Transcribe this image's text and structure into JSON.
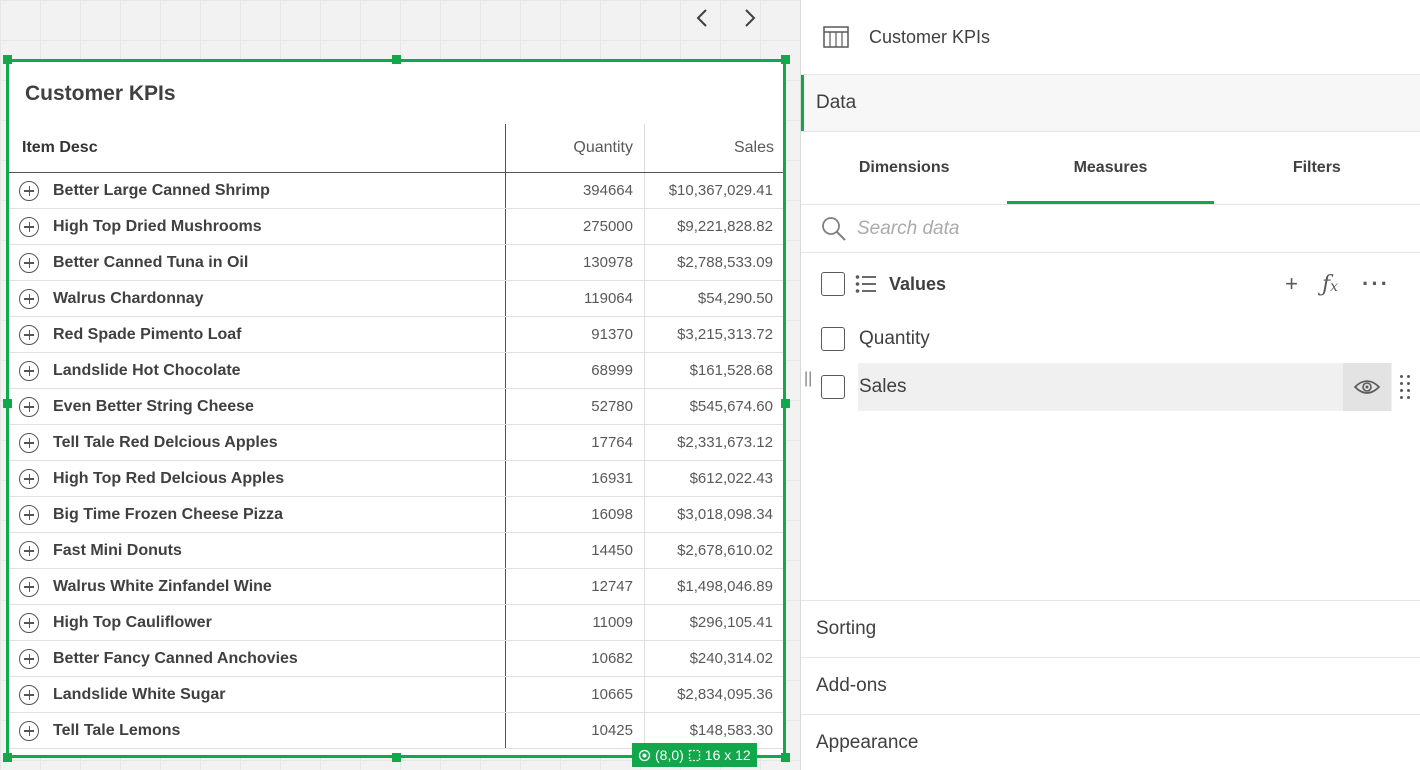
{
  "canvas": {
    "object_title": "Customer KPIs",
    "position_badge": "(8,0)",
    "size_badge": "16 x 12"
  },
  "table": {
    "headers": {
      "desc": "Item Desc",
      "qty": "Quantity",
      "sales": "Sales"
    },
    "rows": [
      {
        "desc": "Better Large Canned Shrimp",
        "qty": "394664",
        "sales": "$10,367,029.41"
      },
      {
        "desc": "High Top Dried Mushrooms",
        "qty": "275000",
        "sales": "$9,221,828.82"
      },
      {
        "desc": "Better Canned Tuna in Oil",
        "qty": "130978",
        "sales": "$2,788,533.09"
      },
      {
        "desc": "Walrus Chardonnay",
        "qty": "119064",
        "sales": "$54,290.50"
      },
      {
        "desc": "Red Spade Pimento Loaf",
        "qty": "91370",
        "sales": "$3,215,313.72"
      },
      {
        "desc": "Landslide Hot Chocolate",
        "qty": "68999",
        "sales": "$161,528.68"
      },
      {
        "desc": "Even Better String Cheese",
        "qty": "52780",
        "sales": "$545,674.60"
      },
      {
        "desc": "Tell Tale Red Delcious Apples",
        "qty": "17764",
        "sales": "$2,331,673.12"
      },
      {
        "desc": "High Top Red Delcious Apples",
        "qty": "16931",
        "sales": "$612,022.43"
      },
      {
        "desc": "Big Time Frozen Cheese Pizza",
        "qty": "16098",
        "sales": "$3,018,098.34"
      },
      {
        "desc": "Fast Mini Donuts",
        "qty": "14450",
        "sales": "$2,678,610.02"
      },
      {
        "desc": "Walrus White Zinfandel Wine",
        "qty": "12747",
        "sales": "$1,498,046.89"
      },
      {
        "desc": "High Top Cauliflower",
        "qty": "11009",
        "sales": "$296,105.41"
      },
      {
        "desc": "Better Fancy Canned Anchovies",
        "qty": "10682",
        "sales": "$240,314.02"
      },
      {
        "desc": "Landslide White Sugar",
        "qty": "10665",
        "sales": "$2,834,095.36"
      },
      {
        "desc": "Tell Tale Lemons",
        "qty": "10425",
        "sales": "$148,583.30"
      }
    ]
  },
  "panel": {
    "title": "Customer KPIs",
    "sections": {
      "data": "Data",
      "sorting": "Sorting",
      "addons": "Add-ons",
      "appearance": "Appearance"
    },
    "tabs": {
      "dimensions": "Dimensions",
      "measures": "Measures",
      "filters": "Filters"
    },
    "search_placeholder": "Search data",
    "values_label": "Values",
    "fields": [
      {
        "label": "Quantity"
      },
      {
        "label": "Sales"
      }
    ],
    "icons": {
      "add": "plus-icon",
      "formula": "fx-icon",
      "more": "more-icon",
      "eye": "eye-icon",
      "drag": "drag-icon"
    }
  },
  "colors": {
    "accent": "#10a84a"
  }
}
